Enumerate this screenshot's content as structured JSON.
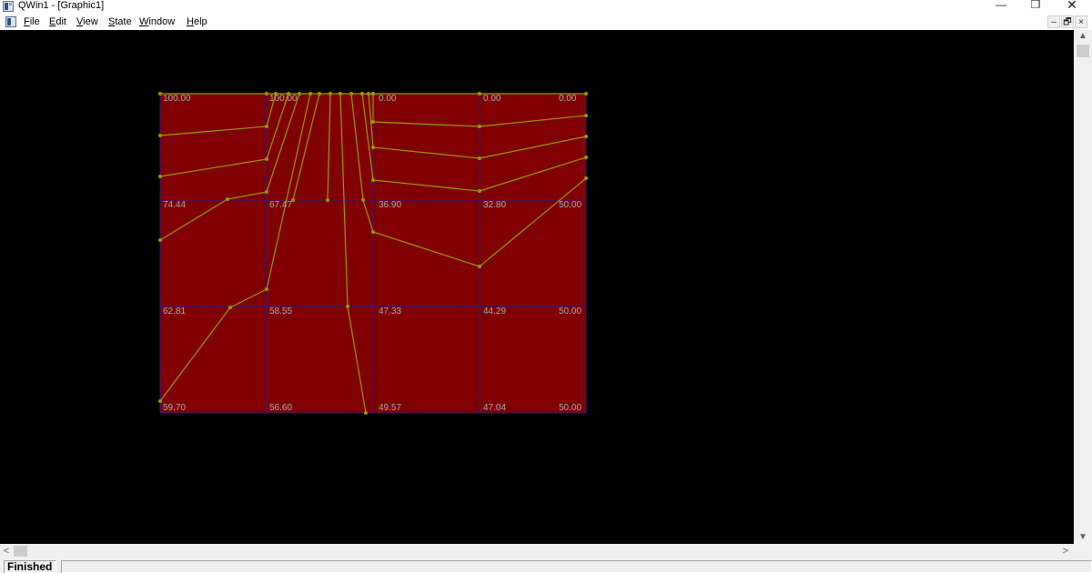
{
  "window": {
    "title": "QWin1 - [Graphic1]",
    "controls": {
      "minimize": "—",
      "restore": "❐",
      "close": "✕"
    }
  },
  "menu": {
    "items": [
      "File",
      "Edit",
      "View",
      "State",
      "Window",
      "Help"
    ],
    "mdi_controls": {
      "minimize": "–",
      "restore": "🗗",
      "close": "×"
    }
  },
  "graphic": {
    "colors": {
      "background": "#000000",
      "fill": "#800000",
      "grid": "#2a1a8c",
      "lines": "#9a9a00",
      "labels": "#a9a9a9"
    },
    "labels": [
      [
        "100.00",
        "100.00",
        "0.00",
        "0.00",
        "0.00"
      ],
      [
        "74.44",
        "67.47",
        "36.90",
        "32.80",
        "50.00"
      ],
      [
        "62.81",
        "58.55",
        "47.33",
        "44.29",
        "50.00"
      ],
      [
        "59.70",
        "56.60",
        "49.57",
        "47.04",
        "50.00"
      ]
    ]
  },
  "scrollbars": {
    "up": "▲",
    "down": "▼",
    "left": "<",
    "right": ">"
  },
  "status": {
    "pane1": "Finished",
    "pane2": ""
  }
}
